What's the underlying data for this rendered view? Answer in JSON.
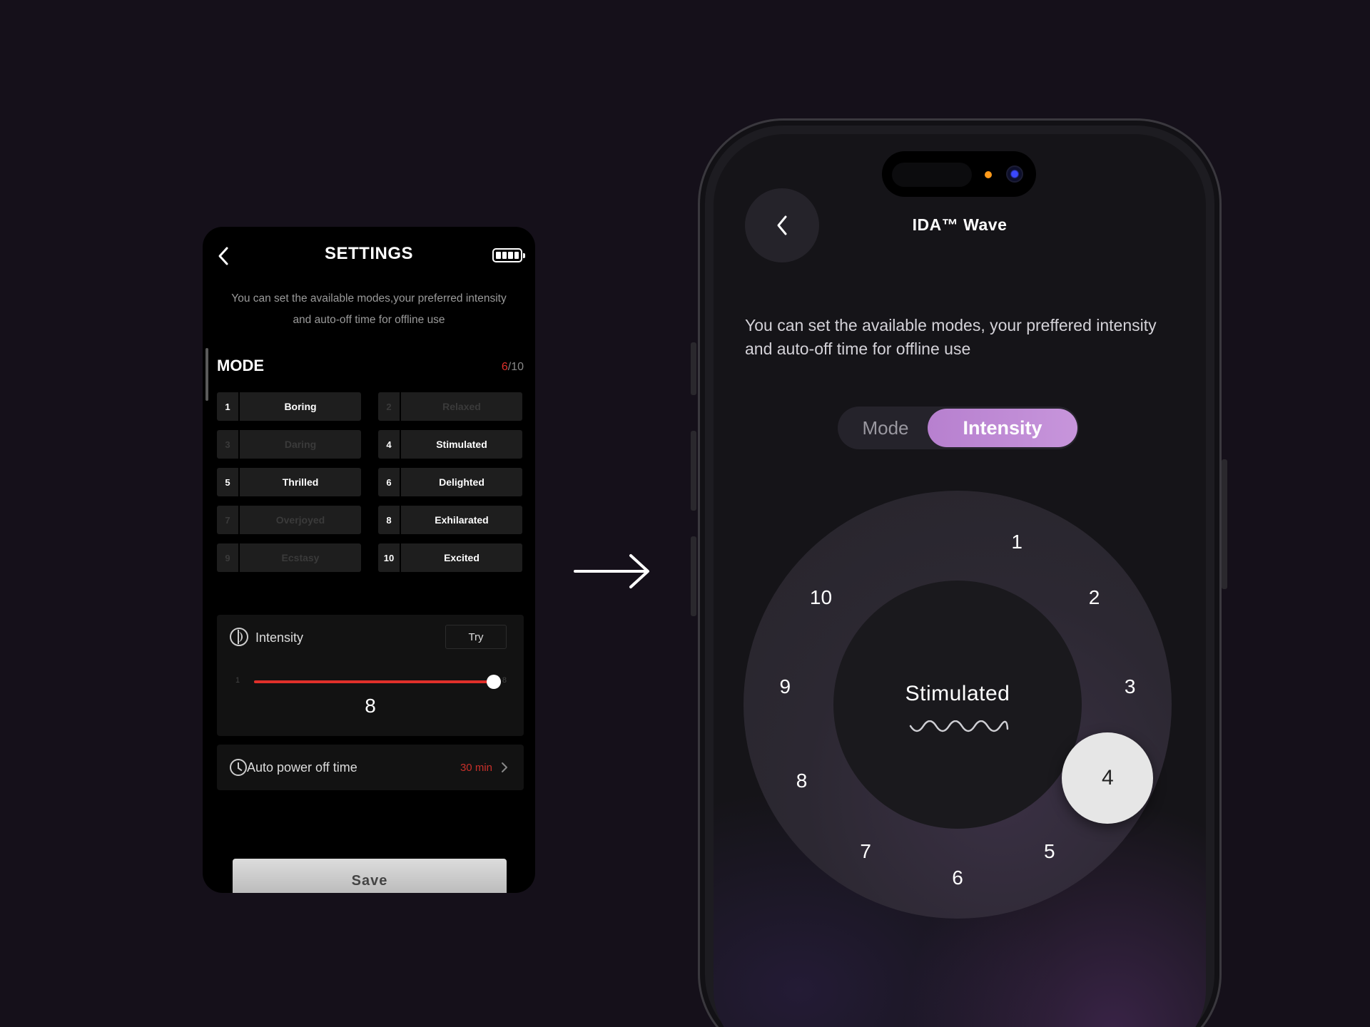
{
  "old_screen": {
    "title": "SETTINGS",
    "description": "You can set the available modes,your preferred intensity and auto-off time for offline use",
    "mode_label": "MODE",
    "mode_count_selected": "6",
    "mode_count_total": "/10",
    "modes": [
      {
        "num": "1",
        "name": "Boring",
        "enabled": true
      },
      {
        "num": "2",
        "name": "Relaxed",
        "enabled": false
      },
      {
        "num": "3",
        "name": "Daring",
        "enabled": false
      },
      {
        "num": "4",
        "name": "Stimulated",
        "enabled": true
      },
      {
        "num": "5",
        "name": "Thrilled",
        "enabled": true
      },
      {
        "num": "6",
        "name": "Delighted",
        "enabled": true
      },
      {
        "num": "7",
        "name": "Overjoyed",
        "enabled": false
      },
      {
        "num": "8",
        "name": "Exhilarated",
        "enabled": true
      },
      {
        "num": "9",
        "name": "Ecstasy",
        "enabled": false
      },
      {
        "num": "10",
        "name": "Excited",
        "enabled": true
      }
    ],
    "intensity": {
      "label": "Intensity",
      "try_label": "Try",
      "min_label": "1",
      "max_label": "8",
      "value": "8",
      "fill_fraction": 1.0
    },
    "auto_power": {
      "label": "Auto power off time",
      "value": "30 min"
    },
    "save_label": "Save",
    "colors": {
      "accent": "#e0302a"
    }
  },
  "new_screen": {
    "title": "IDA™ Wave",
    "description": "You can set the available modes, your preffered intensity and auto-off time for offline use",
    "segment": {
      "mode_label": "Mode",
      "intensity_label": "Intensity",
      "active": "Intensity"
    },
    "dial": {
      "center_label": "Stimulated",
      "numbers": [
        "1",
        "2",
        "3",
        "4",
        "5",
        "6",
        "7",
        "8",
        "9",
        "10"
      ],
      "selected": "4"
    },
    "colors": {
      "accent": "#c08ad6"
    }
  },
  "icons": [
    "chevron-left-icon",
    "battery-icon",
    "intensity-icon",
    "clock-icon",
    "chevron-right-icon",
    "arrow-right-icon",
    "wave-icon"
  ]
}
